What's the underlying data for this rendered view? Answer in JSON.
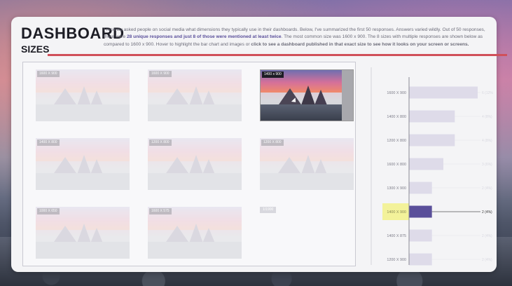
{
  "header": {
    "title": "DASHBOARD",
    "subtitle": "SIZES",
    "intro_p1": "I recently asked people on social media what dimensions they typically use in their dashboards. Below, I've summarized the first 50 responses. Answers varied wildly. Out of 50 responses, there were ",
    "intro_b1": "28 unique responses and just 8 of those were mentioned at least twice",
    "intro_p2": ". The most common size was 1600 x 900. The 8 sizes with multiple responses are shown below as compared to 1600 x 900. Hover to highlight the bar chart and images or ",
    "intro_b2": "click to see a dashboard published in that exact size to see how it looks on your screen or screens.",
    "accent_color": "#d0505a",
    "highlight_color": "#5a4f9a"
  },
  "thumbnails": [
    {
      "label": "1600 X 900",
      "active": false
    },
    {
      "label": "1600 X 900",
      "active": false
    },
    {
      "label": "1400 x 900",
      "active": true
    },
    {
      "label": "1400 X 800",
      "active": false
    },
    {
      "label": "1200 X 800",
      "active": false
    },
    {
      "label": "1200 X 800",
      "active": false
    },
    {
      "label": "1000 X 650",
      "active": false
    },
    {
      "label": "1600 X 575",
      "active": false
    },
    {
      "label": "1/1900",
      "active": false
    }
  ],
  "chart_data": {
    "type": "bar",
    "categories": [
      "1600 X 900",
      "1400 X 800",
      "1200 X 800",
      "1600 X 800",
      "1300 X 900",
      "1400 X 900",
      "1400 X 875",
      "1200 X 900"
    ],
    "values": [
      6,
      4,
      4,
      3,
      2,
      2,
      2,
      2
    ],
    "value_labels": [
      "6 (12%)",
      "4 (8%)",
      "4 (8%)",
      "3 (6%)",
      "2 (4%)",
      "2 (4%)",
      "2 (4%)",
      "2 (4%)"
    ],
    "highlighted_category": "1400 X 900",
    "bar_color": "#dedbe9",
    "highlight_bar_color": "#5a4f9a",
    "highlight_label_bg": "#f3f29a",
    "title": "",
    "xlabel": "",
    "ylabel": "",
    "xlim": [
      0,
      6
    ],
    "grid": false
  }
}
